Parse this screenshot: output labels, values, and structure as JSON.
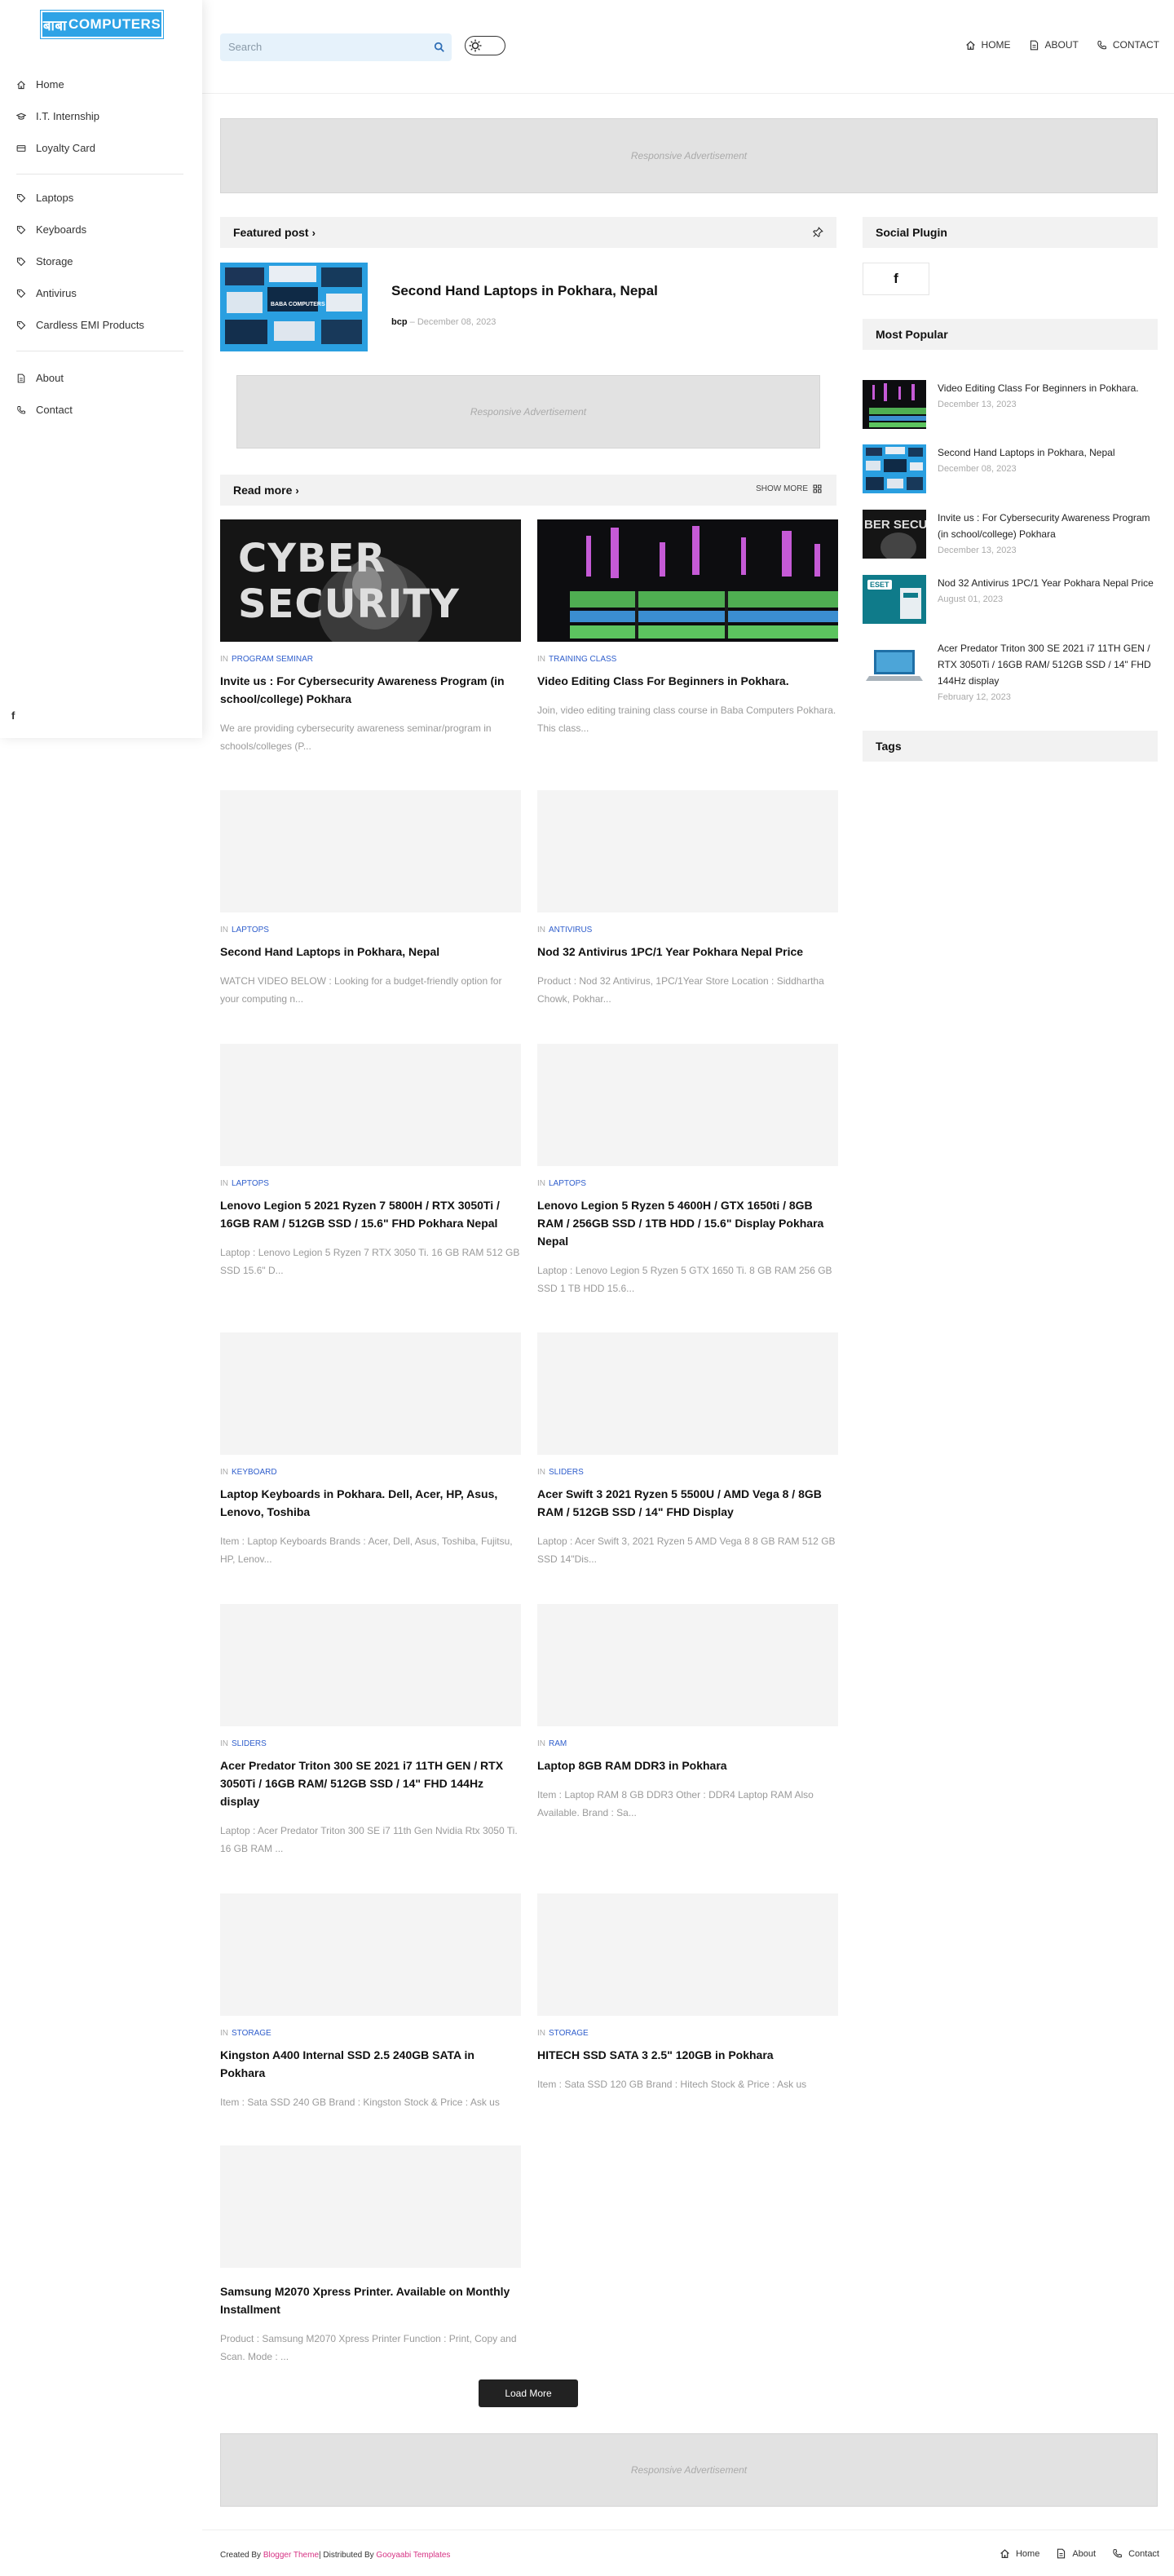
{
  "brand": {
    "logo_devanagari": "बाबा",
    "logo_text": "COMPUTERS",
    "accent": "#2ea3e6"
  },
  "sidebar": {
    "items": [
      {
        "label": "Home",
        "icon": "home-icon"
      },
      {
        "label": "I.T. Internship",
        "icon": "graduation-cap-icon"
      },
      {
        "label": "Loyalty Card",
        "icon": "card-icon"
      },
      {
        "label": "Laptops",
        "icon": "tag-icon"
      },
      {
        "label": "Keyboards",
        "icon": "tag-icon"
      },
      {
        "label": "Storage",
        "icon": "tag-icon"
      },
      {
        "label": "Antivirus",
        "icon": "tag-icon"
      },
      {
        "label": "Cardless EMI Products",
        "icon": "tag-icon"
      },
      {
        "label": "About",
        "icon": "file-icon"
      },
      {
        "label": "Contact",
        "icon": "phone-icon"
      }
    ],
    "social": "f"
  },
  "header": {
    "search_placeholder": "Search",
    "nav": [
      {
        "label": "HOME",
        "icon": "home-icon"
      },
      {
        "label": "ABOUT",
        "icon": "file-icon"
      },
      {
        "label": "CONTACT",
        "icon": "phone-icon"
      }
    ]
  },
  "ads": {
    "label": "Responsive Advertisement"
  },
  "featured": {
    "heading": "Featured post",
    "title": "Second Hand Laptops in Pokhara, Nepal",
    "author": "bcp",
    "date": "December 08, 2023",
    "thumb_caption": "BABA COMPUTERS"
  },
  "readmore": {
    "heading": "Read more",
    "show_more": "SHOW MORE"
  },
  "posts": [
    {
      "category": "PROGRAM SEMINAR",
      "title": "Invite us : For Cybersecurity Awareness Program (in school/college) Pokhara",
      "snippet": "We are providing cybersecurity awareness seminar/program in schools/colleges (P...",
      "thumb": "cyber",
      "thumb_text": "CYBER SECURITY"
    },
    {
      "category": "TRAINING CLASS",
      "title": "Video Editing Class For Beginners in Pokhara.",
      "snippet": "Join, video editing training class course in Baba Computers Pokhara. This class...",
      "thumb": "video"
    },
    {
      "category": "LAPTOPS",
      "title": "Second Hand Laptops in Pokhara, Nepal",
      "snippet": "WATCH VIDEO BELOW :  Looking for a budget-friendly option for your computing n...",
      "thumb": "blank"
    },
    {
      "category": "ANTIVIRUS",
      "title": "Nod 32 Antivirus 1PC/1 Year Pokhara Nepal Price",
      "snippet": "Product : Nod 32 Antivirus, 1PC/1Year Store Location : Siddhartha Chowk, Pokhar...",
      "thumb": "blank"
    },
    {
      "category": "LAPTOPS",
      "title": "Lenovo Legion 5 2021 Ryzen 7 5800H / RTX 3050Ti / 16GB RAM / 512GB SSD / 15.6\" FHD Pokhara Nepal",
      "snippet": "Laptop : Lenovo Legion 5 Ryzen 7 RTX 3050 Ti. 16 GB RAM 512 GB SSD 15.6\" D...",
      "thumb": "blank"
    },
    {
      "category": "LAPTOPS",
      "title": "Lenovo Legion 5 Ryzen 5 4600H / GTX 1650ti / 8GB RAM / 256GB SSD / 1TB HDD / 15.6\" Display Pokhara Nepal",
      "snippet": "Laptop : Lenovo Legion 5 Ryzen 5 GTX 1650 Ti. 8 GB RAM 256 GB SSD 1 TB HDD 15.6...",
      "thumb": "blank"
    },
    {
      "category": "KEYBOARD",
      "title": "Laptop Keyboards in Pokhara. Dell, Acer, HP, Asus, Lenovo, Toshiba",
      "snippet": "Item : Laptop Keyboards  Brands : Acer, Dell, Asus, Toshiba, Fujitsu, HP, Lenov...",
      "thumb": "blank"
    },
    {
      "category": "SLIDERS",
      "title": "Acer Swift 3 2021 Ryzen 5 5500U / AMD Vega 8 / 8GB RAM / 512GB SSD / 14\" FHD Display",
      "snippet": "Laptop : Acer Swift 3, 2021 Ryzen 5 AMD Vega 8 8 GB RAM 512 GB SSD 14\"Dis...",
      "thumb": "blank"
    },
    {
      "category": "SLIDERS",
      "title": "Acer Predator Triton 300 SE 2021 i7 11TH GEN / RTX 3050Ti / 16GB RAM/ 512GB SSD / 14\" FHD 144Hz display",
      "snippet": "Laptop : Acer Predator Triton 300 SE i7 11th Gen Nvidia Rtx 3050 Ti. 16 GB RAM ...",
      "thumb": "blank"
    },
    {
      "category": "RAM",
      "title": "Laptop 8GB RAM DDR3 in Pokhara",
      "snippet": "Item : Laptop RAM 8 GB DDR3  Other : DDR4 Laptop RAM Also Available. Brand : Sa...",
      "thumb": "blank"
    },
    {
      "category": "STORAGE",
      "title": "Kingston A400 Internal SSD 2.5 240GB SATA in Pokhara",
      "snippet": "Item : Sata SSD 240 GB  Brand : Kingston Stock & Price : Ask us",
      "thumb": "blank"
    },
    {
      "category": "STORAGE",
      "title": "HITECH SSD SATA 3 2.5\" 120GB in Pokhara",
      "snippet": "Item : Sata SSD 120 GB Brand : Hitech Stock & Price : Ask us",
      "thumb": "blank"
    },
    {
      "category": "",
      "title": "Samsung M2070 Xpress Printer. Available on Monthly Installment",
      "snippet": "Product : Samsung M2070 Xpress Printer Function : Print, Copy and Scan. Mode : ...",
      "thumb": "blank"
    }
  ],
  "load_more": "Load More",
  "right": {
    "social_heading": "Social Plugin",
    "social_fb": "f",
    "popular_heading": "Most Popular",
    "popular": [
      {
        "title": "Video Editing Class For Beginners in Pokhara.",
        "date": "December 13, 2023",
        "thumb": "video"
      },
      {
        "title": "Second Hand Laptops in Pokhara, Nepal",
        "date": "December 08, 2023",
        "thumb": "laptops"
      },
      {
        "title": "Invite us : For Cybersecurity Awareness Program (in school/college) Pokhara",
        "date": "December 13, 2023",
        "thumb": "cyber",
        "thumb_text": "BER SECUI"
      },
      {
        "title": "Nod 32 Antivirus 1PC/1 Year Pokhara Nepal Price",
        "date": "August 01, 2023",
        "thumb": "eset",
        "thumb_text": "ESET"
      },
      {
        "title": "Acer Predator Triton 300 SE 2021 i7 11TH GEN / RTX 3050Ti / 16GB RAM/ 512GB SSD / 14\" FHD 144Hz display",
        "date": "February 12, 2023",
        "thumb": "laptop"
      }
    ],
    "tags_heading": "Tags"
  },
  "footer": {
    "created_by": "Created By",
    "blogger_theme": "Blogger Theme",
    "distributed_by": "| Distributed By",
    "gooyaabi": "Gooyaabi Templates",
    "nav": [
      {
        "label": "Home",
        "icon": "home-icon"
      },
      {
        "label": "About",
        "icon": "file-icon"
      },
      {
        "label": "Contact",
        "icon": "phone-icon"
      }
    ]
  }
}
